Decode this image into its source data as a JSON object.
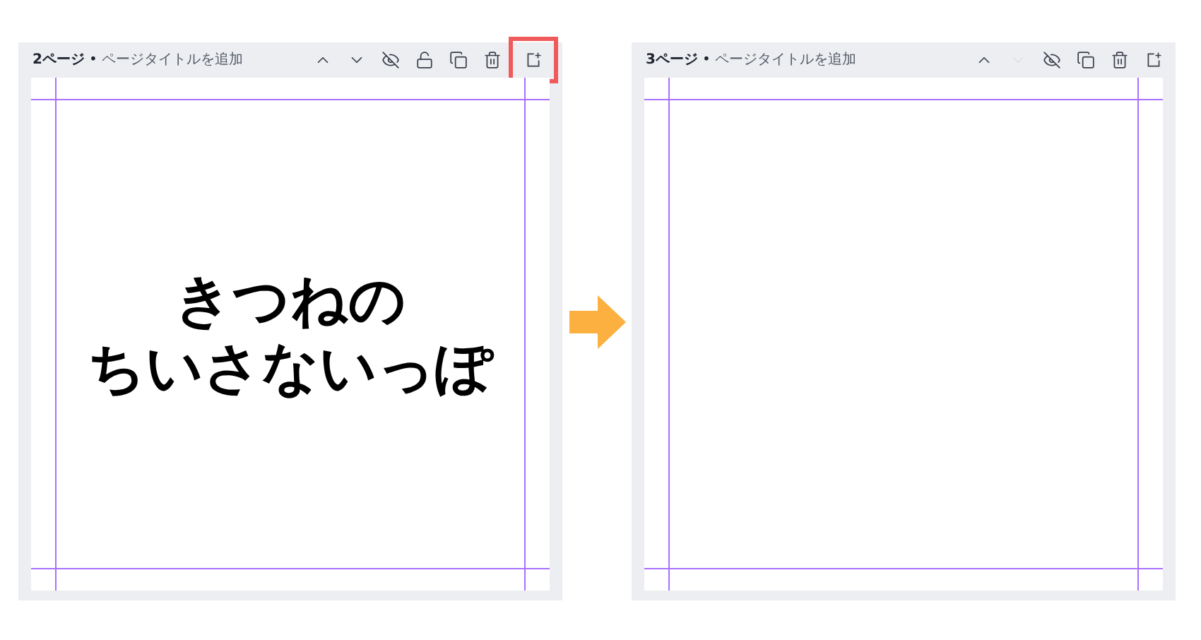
{
  "pages": [
    {
      "label": "2ページ",
      "separator": "•",
      "title": "ページタイトルを追加",
      "text_lines": [
        "きつねの",
        "ちいさないっぽ"
      ],
      "actions": [
        {
          "kind": "up",
          "disabled": false,
          "highlighted": false
        },
        {
          "kind": "down",
          "disabled": false,
          "highlighted": false
        },
        {
          "kind": "hide",
          "disabled": false,
          "highlighted": false
        },
        {
          "kind": "lock",
          "disabled": false,
          "highlighted": false
        },
        {
          "kind": "duplicate",
          "disabled": false,
          "highlighted": false
        },
        {
          "kind": "delete",
          "disabled": false,
          "highlighted": false
        },
        {
          "kind": "add",
          "disabled": false,
          "highlighted": true
        }
      ]
    },
    {
      "label": "3ページ",
      "separator": "•",
      "title": "ページタイトルを追加",
      "actions": [
        {
          "kind": "up",
          "disabled": false,
          "highlighted": false
        },
        {
          "kind": "down",
          "disabled": true,
          "highlighted": false
        },
        {
          "kind": "hide",
          "disabled": false,
          "highlighted": false
        },
        {
          "kind": "duplicate",
          "disabled": false,
          "highlighted": false
        },
        {
          "kind": "delete",
          "disabled": false,
          "highlighted": false
        },
        {
          "kind": "add",
          "disabled": false,
          "highlighted": false
        }
      ]
    }
  ]
}
